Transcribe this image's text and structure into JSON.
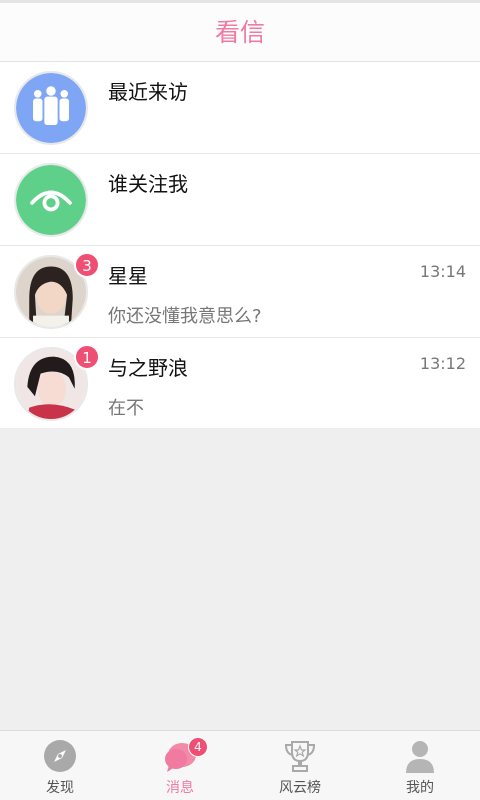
{
  "header": {
    "title": "看信"
  },
  "items": [
    {
      "title": "最近来访",
      "icon": "visitors-icon"
    },
    {
      "title": "谁关注我",
      "icon": "eye-icon"
    },
    {
      "title": "星星",
      "preview": "你还没懂我意思么?",
      "time": "13:14",
      "unread": "3"
    },
    {
      "title": "与之野浪",
      "preview": "在不",
      "time": "13:12",
      "unread": "1"
    }
  ],
  "tabs": [
    {
      "label": "发现",
      "icon": "compass-icon"
    },
    {
      "label": "消息",
      "icon": "chat-bubble-icon",
      "badge": "4",
      "active": true
    },
    {
      "label": "风云榜",
      "icon": "trophy-icon"
    },
    {
      "label": "我的",
      "icon": "person-icon"
    }
  ],
  "colors": {
    "accent": "#f07aa0",
    "badge": "#ef4f72",
    "visitors": "#7fa6f5",
    "follow": "#5fd08a"
  }
}
